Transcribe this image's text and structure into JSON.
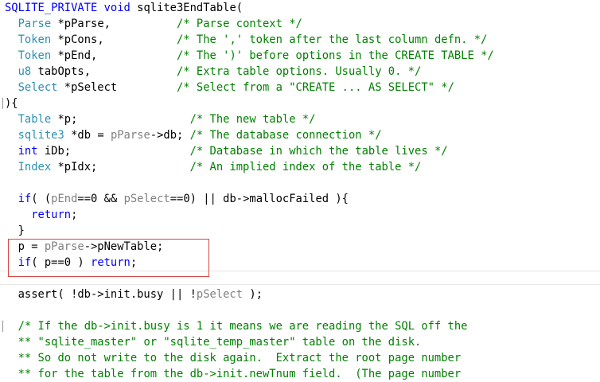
{
  "editor": {
    "lines": [
      [
        {
          "c": "kw",
          "t": "SQLITE_PRIVATE"
        },
        {
          "c": "pl",
          "t": " "
        },
        {
          "c": "kw",
          "t": "void"
        },
        {
          "c": "pl",
          "t": " sqlite3EndTable("
        }
      ],
      [
        {
          "c": "pl",
          "t": "  "
        },
        {
          "c": "ty",
          "t": "Parse"
        },
        {
          "c": "pl",
          "t": " *pParse,          "
        },
        {
          "c": "cm",
          "t": "/* Parse context */"
        }
      ],
      [
        {
          "c": "pl",
          "t": "  "
        },
        {
          "c": "ty",
          "t": "Token"
        },
        {
          "c": "pl",
          "t": " *pCons,           "
        },
        {
          "c": "cm",
          "t": "/* The ',' token after the last column defn. */"
        }
      ],
      [
        {
          "c": "pl",
          "t": "  "
        },
        {
          "c": "ty",
          "t": "Token"
        },
        {
          "c": "pl",
          "t": " *pEnd,            "
        },
        {
          "c": "cm",
          "t": "/* The ')' before options in the CREATE TABLE */"
        }
      ],
      [
        {
          "c": "pl",
          "t": "  "
        },
        {
          "c": "ty",
          "t": "u8"
        },
        {
          "c": "pl",
          "t": " tabOpts,             "
        },
        {
          "c": "cm",
          "t": "/* Extra table options. Usually 0. */"
        }
      ],
      [
        {
          "c": "pl",
          "t": "  "
        },
        {
          "c": "ty",
          "t": "Select"
        },
        {
          "c": "pl",
          "t": " *pSelect         "
        },
        {
          "c": "cm",
          "t": "/* Select from a \"CREATE ... AS SELECT\" */"
        }
      ],
      [
        {
          "c": "pl",
          "t": "){"
        }
      ],
      [
        {
          "c": "pl",
          "t": "  "
        },
        {
          "c": "ty",
          "t": "Table"
        },
        {
          "c": "pl",
          "t": " *p;                 "
        },
        {
          "c": "cm",
          "t": "/* The new table */"
        }
      ],
      [
        {
          "c": "pl",
          "t": "  "
        },
        {
          "c": "ty",
          "t": "sqlite3"
        },
        {
          "c": "pl",
          "t": " *db = "
        },
        {
          "c": "pr",
          "t": "pParse"
        },
        {
          "c": "pl",
          "t": "->db; "
        },
        {
          "c": "cm",
          "t": "/* The database connection */"
        }
      ],
      [
        {
          "c": "pl",
          "t": "  "
        },
        {
          "c": "kw",
          "t": "int"
        },
        {
          "c": "pl",
          "t": " iDb;                  "
        },
        {
          "c": "cm",
          "t": "/* Database in which the table lives */"
        }
      ],
      [
        {
          "c": "pl",
          "t": "  "
        },
        {
          "c": "ty",
          "t": "Index"
        },
        {
          "c": "pl",
          "t": " *pIdx;              "
        },
        {
          "c": "cm",
          "t": "/* An implied index of the table */"
        }
      ],
      [
        {
          "c": "pl",
          "t": ""
        }
      ],
      [
        {
          "c": "pl",
          "t": "  "
        },
        {
          "c": "kw",
          "t": "if"
        },
        {
          "c": "pl",
          "t": "( ("
        },
        {
          "c": "pr",
          "t": "pEnd"
        },
        {
          "c": "pl",
          "t": "==0 && "
        },
        {
          "c": "pr",
          "t": "pSelect"
        },
        {
          "c": "pl",
          "t": "==0) || db->mallocFailed ){"
        }
      ],
      [
        {
          "c": "pl",
          "t": "    "
        },
        {
          "c": "kw",
          "t": "return"
        },
        {
          "c": "pl",
          "t": ";"
        }
      ],
      [
        {
          "c": "pl",
          "t": "  }"
        }
      ],
      [
        {
          "c": "pl",
          "t": "  p = "
        },
        {
          "c": "pr",
          "t": "pParse"
        },
        {
          "c": "pl",
          "t": "->pNewTable;"
        }
      ],
      [
        {
          "c": "pl",
          "t": "  "
        },
        {
          "c": "kw",
          "t": "if"
        },
        {
          "c": "pl",
          "t": "( p==0 ) "
        },
        {
          "c": "kw",
          "t": "return"
        },
        {
          "c": "pl",
          "t": ";"
        }
      ],
      [
        {
          "c": "pl",
          "t": ""
        }
      ],
      [
        {
          "c": "pl",
          "t": "  assert( !db->init.busy || !"
        },
        {
          "c": "pr",
          "t": "pSelect"
        },
        {
          "c": "pl",
          "t": " );"
        }
      ],
      [
        {
          "c": "pl",
          "t": ""
        }
      ],
      [
        {
          "c": "pl",
          "t": "  "
        },
        {
          "c": "cm",
          "t": "/* If the db->init.busy is 1 it means we are reading the SQL off the"
        }
      ],
      [
        {
          "c": "pl",
          "t": "  "
        },
        {
          "c": "cm",
          "t": "** \"sqlite_master\" or \"sqlite_temp_master\" table on the disk."
        }
      ],
      [
        {
          "c": "pl",
          "t": "  "
        },
        {
          "c": "cm",
          "t": "** So do not write to the disk again.  Extract the root page number"
        }
      ],
      [
        {
          "c": "pl",
          "t": "  "
        },
        {
          "c": "cm",
          "t": "** for the table from the db->init.newTnum field.  (The page number"
        }
      ]
    ],
    "gutter_marks": {
      "6": "│",
      "20": "│"
    },
    "colors": {
      "keyword": "#0000ff",
      "type": "#2b91af",
      "comment": "#008000",
      "parameter": "#808080",
      "highlight_box": "#d64545"
    }
  }
}
